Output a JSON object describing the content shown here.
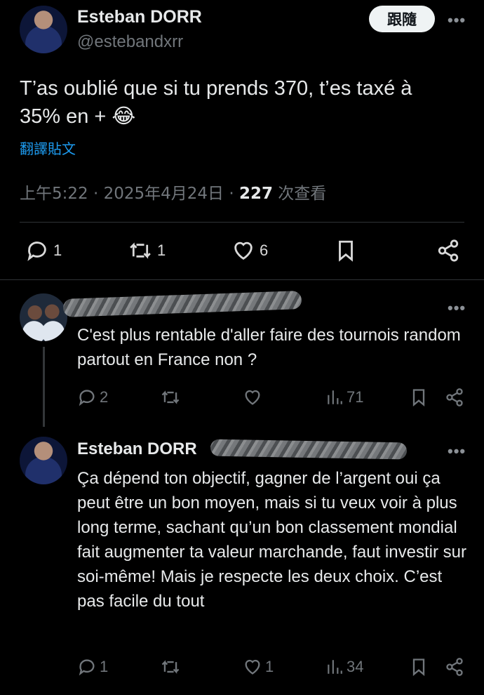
{
  "main_tweet": {
    "author_name": "Esteban DORR",
    "author_handle": "@estebandxrr",
    "follow_label": "跟隨",
    "text": "T’as oublié que si tu prends 370, t’es taxé à 35% en +",
    "emoji": "😂",
    "translate_label": "翻譯貼文",
    "time": "上午5:22",
    "date": "2025年4月24日",
    "views_count": "227",
    "views_label": "次查看",
    "reply_count": "1",
    "retweet_count": "1",
    "like_count": "6",
    "dot": "·"
  },
  "reply1": {
    "text": "C'est plus rentable d'aller faire des tournois random partout en France non ?",
    "reply_count": "2",
    "view_count": "71"
  },
  "reply2": {
    "author_name": "Esteban DORR",
    "text": "Ça dépend ton objectif, gagner de l’argent oui ça peut être un bon moyen, mais si tu veux voir à plus long terme, sachant qu’un bon classement mondial fait augmenter ta valeur marchande, faut investir sur soi-même! Mais je respecte les deux choix. C’est pas facile du tout",
    "reply_count": "1",
    "like_count": "1",
    "view_count": "34"
  },
  "more_label": "•••",
  "colors": {
    "background": "#000000",
    "text": "#e7e9ea",
    "muted": "#71767b",
    "link": "#1d9bf0",
    "divider": "#2f3336"
  }
}
